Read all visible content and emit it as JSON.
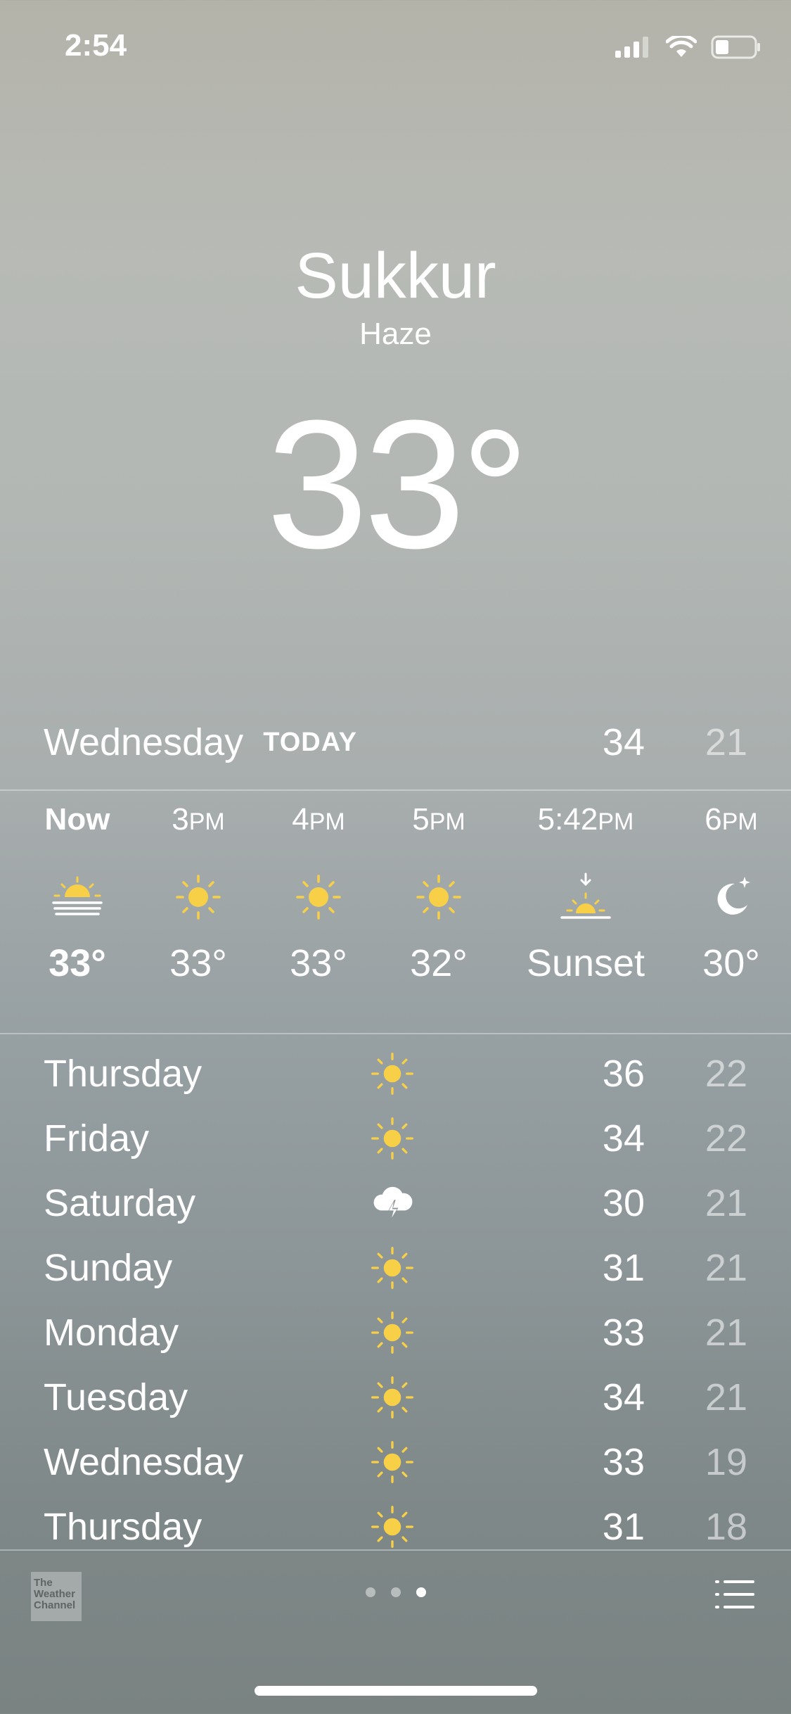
{
  "status": {
    "time": "2:54"
  },
  "header": {
    "city": "Sukkur",
    "condition": "Haze",
    "temp": "33",
    "deg": "°"
  },
  "today": {
    "day": "Wednesday",
    "label": "TODAY",
    "high": "34",
    "low": "21"
  },
  "hourly": [
    {
      "time": "Now",
      "suffix": "",
      "icon": "haze-sun-icon",
      "value": "33°"
    },
    {
      "time": "3",
      "suffix": "PM",
      "icon": "sun-icon",
      "value": "33°"
    },
    {
      "time": "4",
      "suffix": "PM",
      "icon": "sun-icon",
      "value": "33°"
    },
    {
      "time": "5",
      "suffix": "PM",
      "icon": "sun-icon",
      "value": "32°"
    },
    {
      "time": "5:42",
      "suffix": "PM",
      "icon": "sunset-icon",
      "value": "Sunset"
    },
    {
      "time": "6",
      "suffix": "PM",
      "icon": "moon-icon",
      "value": "30°"
    }
  ],
  "daily": [
    {
      "day": "Thursday",
      "icon": "sun-icon",
      "high": "36",
      "low": "22"
    },
    {
      "day": "Friday",
      "icon": "sun-icon",
      "high": "34",
      "low": "22"
    },
    {
      "day": "Saturday",
      "icon": "thunderstorm-icon",
      "high": "30",
      "low": "21"
    },
    {
      "day": "Sunday",
      "icon": "sun-icon",
      "high": "31",
      "low": "21"
    },
    {
      "day": "Monday",
      "icon": "sun-icon",
      "high": "33",
      "low": "21"
    },
    {
      "day": "Tuesday",
      "icon": "sun-icon",
      "high": "34",
      "low": "21"
    },
    {
      "day": "Wednesday",
      "icon": "sun-icon",
      "high": "33",
      "low": "19"
    },
    {
      "day": "Thursday",
      "icon": "sun-icon",
      "high": "31",
      "low": "18"
    }
  ],
  "footer": {
    "logo_lines": [
      "The",
      "Weather",
      "Channel"
    ],
    "pages": 3,
    "active_page": 3
  },
  "colors": {
    "sun": "#f7d048",
    "text": "#ffffff",
    "low_temp": "rgba(255,255,255,0.55)"
  }
}
